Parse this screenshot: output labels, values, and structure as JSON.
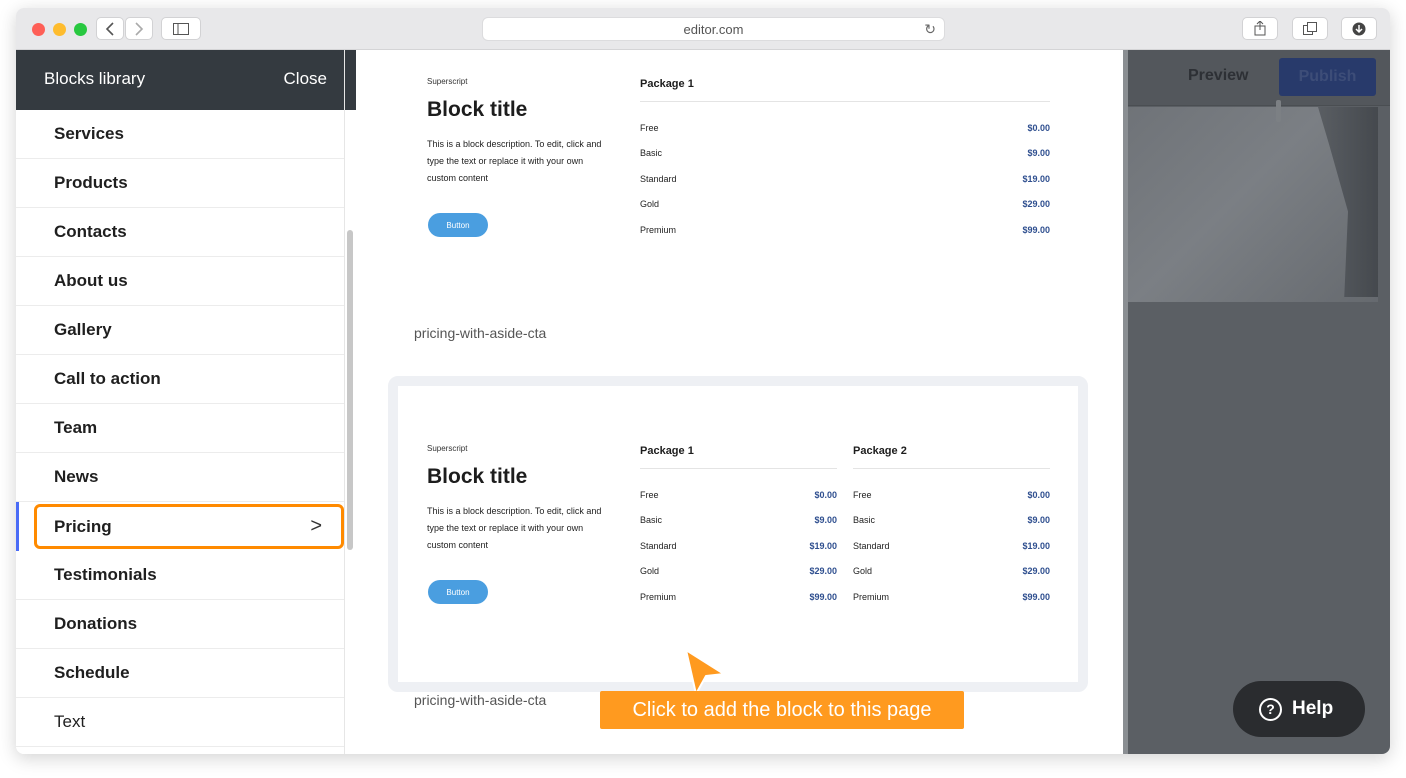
{
  "browser": {
    "url": "editor.com",
    "back_icon": "chevron-left-icon",
    "forward_icon": "chevron-right-icon",
    "sidebar_icon": "sidebar-icon",
    "share_icon": "share-icon",
    "tabs_icon": "tabs-icon",
    "download_icon": "download-icon"
  },
  "sidebar": {
    "title": "Blocks library",
    "close_label": "Close",
    "items": [
      {
        "label": "Services"
      },
      {
        "label": "Products"
      },
      {
        "label": "Contacts"
      },
      {
        "label": "About us"
      },
      {
        "label": "Gallery"
      },
      {
        "label": "Call to action"
      },
      {
        "label": "Team"
      },
      {
        "label": "News"
      },
      {
        "label": "Pricing",
        "active": true
      },
      {
        "label": "Testimonials"
      },
      {
        "label": "Donations"
      },
      {
        "label": "Schedule"
      },
      {
        "label": "Text"
      }
    ],
    "accent_color": "#ff8a00",
    "active_bar_color": "#4a6cf7"
  },
  "blocks": [
    {
      "superscript": "Superscript",
      "title": "Block title",
      "description": "This is a block description. To edit, click and type the text or replace it with your own custom content",
      "button_label": "Button",
      "caption": "pricing-with-aside-cta",
      "packages": [
        {
          "name": "Package 1",
          "rows": [
            {
              "name": "Free",
              "price": "$0.00"
            },
            {
              "name": "Basic",
              "price": "$9.00"
            },
            {
              "name": "Standard",
              "price": "$19.00"
            },
            {
              "name": "Gold",
              "price": "$29.00"
            },
            {
              "name": "Premium",
              "price": "$99.00"
            }
          ]
        }
      ]
    },
    {
      "superscript": "Superscript",
      "title": "Block title",
      "description": "This is a block description. To edit, click and type the text or replace it with your own custom content",
      "button_label": "Button",
      "caption": "pricing-with-aside-cta",
      "packages": [
        {
          "name": "Package 1",
          "rows": [
            {
              "name": "Free",
              "price": "$0.00"
            },
            {
              "name": "Basic",
              "price": "$9.00"
            },
            {
              "name": "Standard",
              "price": "$19.00"
            },
            {
              "name": "Gold",
              "price": "$29.00"
            },
            {
              "name": "Premium",
              "price": "$99.00"
            }
          ]
        },
        {
          "name": "Package 2",
          "rows": [
            {
              "name": "Free",
              "price": "$0.00"
            },
            {
              "name": "Basic",
              "price": "$9.00"
            },
            {
              "name": "Standard",
              "price": "$19.00"
            },
            {
              "name": "Gold",
              "price": "$29.00"
            },
            {
              "name": "Premium",
              "price": "$99.00"
            }
          ]
        }
      ]
    }
  ],
  "tooltip": {
    "text": "Click to add the block to this page",
    "color": "#ff9a1f"
  },
  "editor": {
    "preview_label": "Preview",
    "publish_label": "Publish",
    "help_label": "Help",
    "help_icon": "question-circle-icon"
  }
}
